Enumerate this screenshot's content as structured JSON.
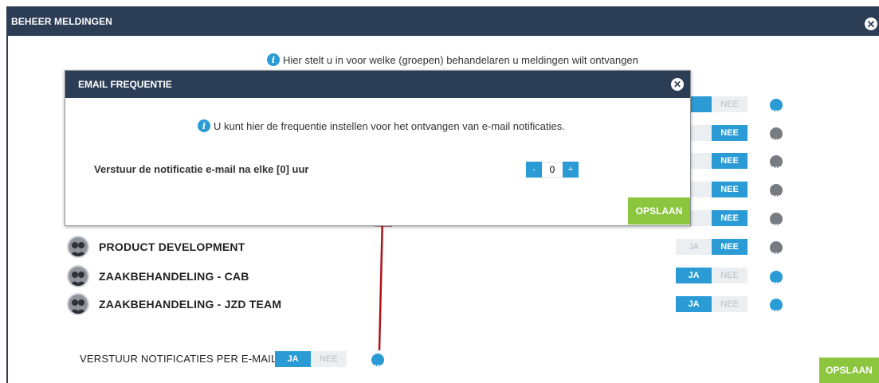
{
  "outer": {
    "title": "BEHEER MELDINGEN",
    "info_text": "Hier stelt u in voor welke (groepen) behandelaren u meldingen wilt ontvangen",
    "close_glyph": "✕"
  },
  "rows_partial": [
    {
      "ja": "",
      "nee": "NEE",
      "ja_on": true,
      "dots": "blue"
    },
    {
      "ja": "",
      "nee": "NEE",
      "ja_on": false,
      "dots": "grey"
    },
    {
      "ja": "",
      "nee": "NEE",
      "ja_on": false,
      "dots": "grey"
    },
    {
      "ja": "",
      "nee": "NEE",
      "ja_on": false,
      "dots": "grey"
    },
    {
      "ja": "",
      "nee": "NEE",
      "ja_on": false,
      "dots": "grey"
    }
  ],
  "groups": [
    {
      "label": "PRODUCT DEVELOPMENT",
      "ja": "JA",
      "nee": "NEE",
      "ja_on": false,
      "dots": "grey"
    },
    {
      "label": "ZAAKBEHANDELING - CAB",
      "ja": "JA",
      "nee": "NEE",
      "ja_on": true,
      "dots": "blue"
    },
    {
      "label": "ZAAKBEHANDELING - JZD TEAM",
      "ja": "JA",
      "nee": "NEE",
      "ja_on": true,
      "dots": "blue"
    }
  ],
  "dots_glyph": "...",
  "email_setting": {
    "label": "VERSTUUR NOTIFICATIES PER E-MAIL",
    "ja": "JA",
    "nee": "NEE"
  },
  "save_label": "OPSLAAN",
  "dialog": {
    "title": "EMAIL FREQUENTIE",
    "info_text": "U kunt hier de frequentie instellen voor het ontvangen van e-mail notificaties.",
    "frequency_label": "Verstuur de notificatie e-mail na elke [0] uur",
    "stepper_minus": "-",
    "stepper_plus": "+",
    "stepper_value": "0",
    "save_label": "OPSLAAN",
    "close_glyph": "✕"
  },
  "info_glyph": "i",
  "colors": {
    "header": "#2c3e56",
    "accent": "#2b9bd5",
    "save": "#8cc63f",
    "annotation_arrow": "#b0121b"
  }
}
